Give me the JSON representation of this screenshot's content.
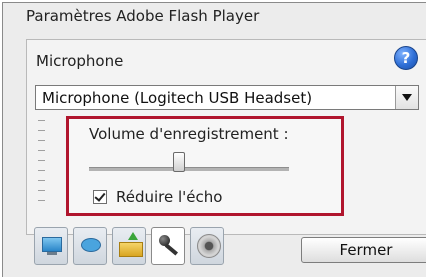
{
  "window": {
    "title": "Paramètres Adobe Flash Player"
  },
  "section": {
    "label": "Microphone",
    "help_icon": "help-icon",
    "help_glyph": "?"
  },
  "device_select": {
    "value": "Microphone (Logitech USB Headset)"
  },
  "recording": {
    "volume_label": "Volume d'enregistrement :",
    "volume_level_fraction": 0.45,
    "echo_label": "Réduire l'écho",
    "echo_checked": true
  },
  "tabs": [
    {
      "icon": "display-icon",
      "active": false
    },
    {
      "icon": "privacy-icon",
      "active": false
    },
    {
      "icon": "local-storage-icon",
      "active": false
    },
    {
      "icon": "microphone-icon",
      "active": true
    },
    {
      "icon": "camera-icon",
      "active": false
    }
  ],
  "close_button": {
    "label": "Fermer"
  },
  "colors": {
    "highlight_border": "#b0152d",
    "help_blue": "#2f6fd6"
  }
}
